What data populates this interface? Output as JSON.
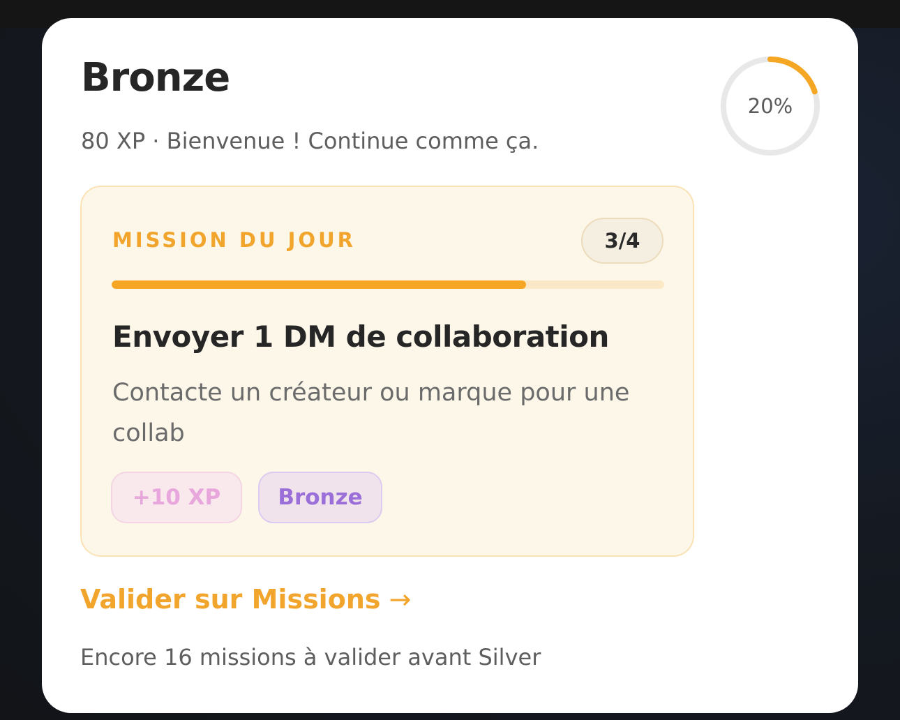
{
  "level": {
    "title": "Bronze",
    "subtitle": "80 XP · Bienvenue ! Continue comme ça.",
    "progress_label": "20%",
    "progress_fraction": 0.2
  },
  "colors": {
    "accent": "#f5a623",
    "ring_track": "#e8e8e8",
    "card_bg": "#ffffff",
    "mission_bg": "#fdf7ea",
    "tier_purple": "#9a6fd8",
    "xp_pink": "#e7a6dc"
  },
  "mission": {
    "label": "MISSION DU JOUR",
    "count": "3/4",
    "progress_fraction": 0.75,
    "title": "Envoyer 1 DM de collaboration",
    "description": "Contacte un créateur ou marque pour une collab",
    "reward_tag": "+10 XP",
    "tier_tag": "Bronze"
  },
  "cta": {
    "label": "Valider sur Missions",
    "arrow_icon": "→"
  },
  "footer": {
    "note": "Encore 16 missions à valider avant Silver"
  }
}
